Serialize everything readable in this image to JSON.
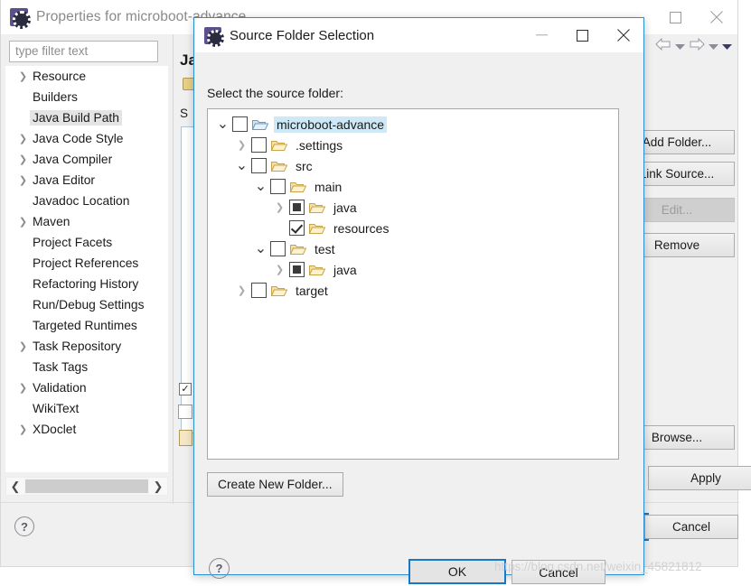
{
  "properties_window": {
    "title": "Properties for microboot-advance",
    "icon": "eclipse-icon",
    "window_controls": {
      "maximize": "maximize-icon",
      "close": "close-icon"
    },
    "filter": {
      "placeholder": "type filter text",
      "value": ""
    },
    "sidebar_items": [
      {
        "label": "Resource",
        "expandable": true,
        "selected": false
      },
      {
        "label": "Builders",
        "expandable": false,
        "selected": false
      },
      {
        "label": "Java Build Path",
        "expandable": false,
        "selected": true
      },
      {
        "label": "Java Code Style",
        "expandable": true,
        "selected": false
      },
      {
        "label": "Java Compiler",
        "expandable": true,
        "selected": false
      },
      {
        "label": "Java Editor",
        "expandable": true,
        "selected": false
      },
      {
        "label": "Javadoc Location",
        "expandable": false,
        "selected": false
      },
      {
        "label": "Maven",
        "expandable": true,
        "selected": false
      },
      {
        "label": "Project Facets",
        "expandable": false,
        "selected": false
      },
      {
        "label": "Project References",
        "expandable": false,
        "selected": false
      },
      {
        "label": "Refactoring History",
        "expandable": false,
        "selected": false
      },
      {
        "label": "Run/Debug Settings",
        "expandable": false,
        "selected": false
      },
      {
        "label": "Targeted Runtimes",
        "expandable": false,
        "selected": false
      },
      {
        "label": "Task Repository",
        "expandable": true,
        "selected": false
      },
      {
        "label": "Task Tags",
        "expandable": false,
        "selected": false
      },
      {
        "label": "Validation",
        "expandable": true,
        "selected": false
      },
      {
        "label": "WikiText",
        "expandable": false,
        "selected": false
      },
      {
        "label": "XDoclet",
        "expandable": true,
        "selected": false
      }
    ],
    "scrollbar": {
      "left_arrow": "chevron-left-icon",
      "right_arrow": "chevron-right-icon"
    },
    "content": {
      "title": "Ja",
      "subtitle": "S"
    },
    "buttons": [
      {
        "label": "Add Folder...",
        "enabled": true
      },
      {
        "label": "Link Source...",
        "enabled": true
      },
      {
        "label": "Edit...",
        "enabled": false
      },
      {
        "label": "Remove",
        "enabled": true
      },
      {
        "label": "Browse...",
        "enabled": true
      },
      {
        "label": "Apply",
        "enabled": true
      }
    ],
    "footer": {
      "apply_close_label": "",
      "cancel_label": "Cancel",
      "help": "help-icon"
    },
    "toolbar": {
      "back": "back-arrow-icon",
      "back_menu": "chevron-down-icon",
      "forward": "forward-arrow-icon",
      "forward_menu": "chevron-down-icon",
      "overflow_menu": "chevron-down-icon"
    }
  },
  "dialog": {
    "title": "Source Folder Selection",
    "icon": "eclipse-icon",
    "window_controls": {
      "minimize": "minimize-icon",
      "maximize": "maximize-icon",
      "close": "close-icon"
    },
    "prompt": "Select the source folder:",
    "tree": [
      {
        "label": "microboot-advance",
        "indent": 0,
        "twisty": "expanded",
        "checkbox": "unchecked",
        "folder": "open-folder-blue-icon",
        "selected": true
      },
      {
        "label": ".settings",
        "indent": 1,
        "twisty": "collapsed",
        "checkbox": "unchecked",
        "folder": "folder-icon",
        "selected": false
      },
      {
        "label": "src",
        "indent": 1,
        "twisty": "expanded",
        "checkbox": "unchecked",
        "folder": "folder-icon",
        "selected": false
      },
      {
        "label": "main",
        "indent": 2,
        "twisty": "expanded",
        "checkbox": "unchecked",
        "folder": "folder-icon",
        "selected": false
      },
      {
        "label": "java",
        "indent": 3,
        "twisty": "collapsed",
        "checkbox": "partial",
        "folder": "folder-icon",
        "selected": false
      },
      {
        "label": "resources",
        "indent": 3,
        "twisty": "none",
        "checkbox": "checked",
        "folder": "folder-icon",
        "selected": false
      },
      {
        "label": "test",
        "indent": 2,
        "twisty": "expanded",
        "checkbox": "unchecked",
        "folder": "folder-icon",
        "selected": false
      },
      {
        "label": "java",
        "indent": 3,
        "twisty": "collapsed",
        "checkbox": "partial",
        "folder": "folder-icon",
        "selected": false
      },
      {
        "label": "target",
        "indent": 1,
        "twisty": "collapsed",
        "checkbox": "unchecked",
        "folder": "folder-icon",
        "selected": false
      }
    ],
    "create_folder_label": "Create New Folder...",
    "help": "help-icon",
    "ok_label": "OK",
    "cancel_label": "Cancel"
  },
  "watermark": "https://blog.csdn.net/weixin_45821812",
  "colors": {
    "dialog_border": "#2a8fd0",
    "focus_border": "#1878c8",
    "tree_selection": "#cde8f6",
    "sidebar_selection": "#e4e4e4",
    "folder_fill": "#f3e0a8",
    "folder_stroke": "#c8a44a"
  }
}
